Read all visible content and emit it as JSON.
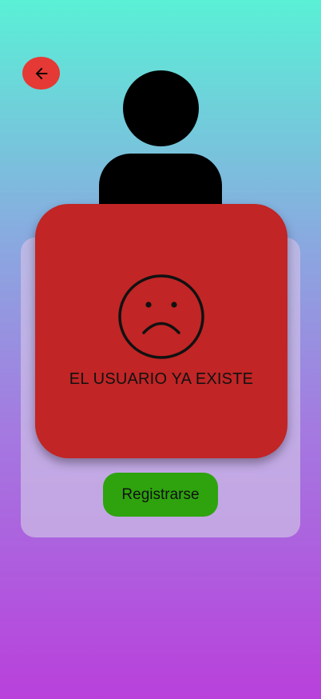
{
  "header": {
    "back_icon": "arrow-left-icon"
  },
  "avatar": {
    "icon": "user-silhouette-icon"
  },
  "form": {
    "register_label": "Registrarse"
  },
  "dialog": {
    "icon": "sad-face-icon",
    "message": "EL USUARIO YA EXISTE"
  },
  "colors": {
    "back_button": "#e53935",
    "dialog_background": "#c12525",
    "register_button": "#2ea30e",
    "gradient_top": "#5af0d6",
    "gradient_bottom": "#b940dc"
  }
}
